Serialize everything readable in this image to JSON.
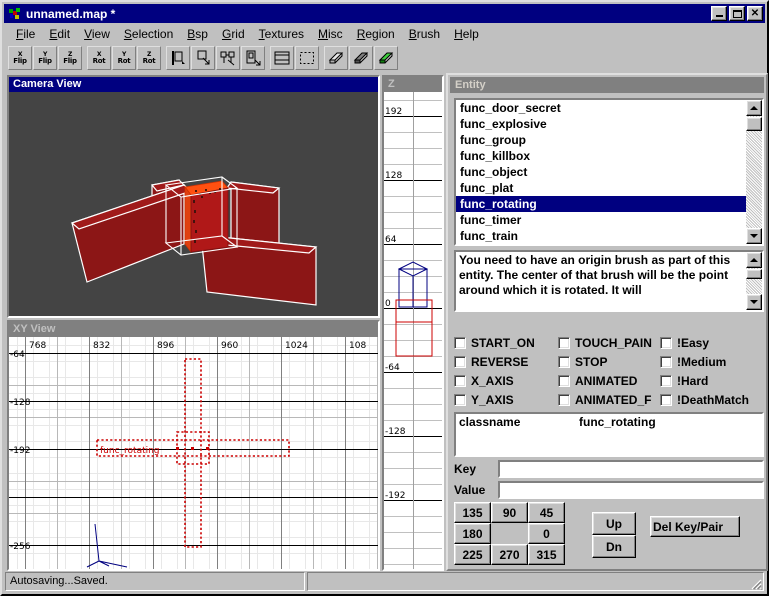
{
  "window": {
    "title": "unnamed.map *",
    "icon": "app-icon",
    "buttons": {
      "minimize": "_",
      "maximize": "□",
      "close": "×"
    }
  },
  "menu": {
    "items": [
      {
        "label": "File",
        "accel": "F"
      },
      {
        "label": "Edit",
        "accel": "E"
      },
      {
        "label": "View",
        "accel": "V"
      },
      {
        "label": "Selection",
        "accel": "S"
      },
      {
        "label": "Bsp",
        "accel": "B"
      },
      {
        "label": "Grid",
        "accel": "G"
      },
      {
        "label": "Textures",
        "accel": "T"
      },
      {
        "label": "Misc",
        "accel": "M"
      },
      {
        "label": "Region",
        "accel": "R"
      },
      {
        "label": "Brush",
        "accel": "B"
      },
      {
        "label": "Help",
        "accel": "H"
      }
    ]
  },
  "toolbar": {
    "buttons": [
      {
        "name": "x-flip-button",
        "top": "X",
        "bottom": "Flip",
        "icon": ""
      },
      {
        "name": "y-flip-button",
        "top": "Y",
        "bottom": "Flip",
        "icon": ""
      },
      {
        "name": "z-flip-button",
        "top": "Z",
        "bottom": "Flip",
        "icon": ""
      },
      {
        "name": "x-rotate-button",
        "top": "X",
        "bottom": "Rot",
        "icon": ""
      },
      {
        "name": "y-rotate-button",
        "top": "Y",
        "bottom": "Rot",
        "icon": ""
      },
      {
        "name": "z-rotate-button",
        "top": "Z",
        "bottom": "Rot",
        "icon": ""
      },
      {
        "name": "clipper-button",
        "top": "",
        "bottom": "",
        "icon": "clipper-icon"
      },
      {
        "name": "selection-drag-button",
        "top": "",
        "bottom": "",
        "icon": "drag-icon"
      },
      {
        "name": "entity-connect-button",
        "top": "",
        "bottom": "",
        "icon": "connect-icon"
      },
      {
        "name": "path-button",
        "top": "",
        "bottom": "",
        "icon": "path-icon"
      },
      {
        "name": "show-coordinates-button",
        "top": "",
        "bottom": "",
        "icon": "grid-window-icon"
      },
      {
        "name": "select-region-button",
        "top": "",
        "bottom": "",
        "icon": "marquee-icon"
      },
      {
        "name": "brush-cut-button",
        "top": "",
        "bottom": "",
        "icon": "brush-icon"
      },
      {
        "name": "brush-hollow-button",
        "top": "",
        "bottom": "",
        "icon": "brush-dark-icon"
      },
      {
        "name": "brush-make-button",
        "top": "",
        "bottom": "",
        "icon": "brush-green-icon"
      }
    ]
  },
  "camera_view": {
    "title": "Camera View"
  },
  "xy_view": {
    "title": "XY View",
    "x_ticks": [
      "768",
      "832",
      "896",
      "960",
      "1024",
      "108"
    ],
    "y_ticks": [
      "-64",
      "-128",
      "-192",
      "-256"
    ],
    "brush_label": "func_rotating"
  },
  "z_view": {
    "title": "Z",
    "ticks": [
      "192",
      "128",
      "64",
      "0",
      "-64",
      "-128",
      "-192"
    ]
  },
  "entity_panel": {
    "title": "Entity",
    "list": [
      "func_door_secret",
      "func_explosive",
      "func_group",
      "func_killbox",
      "func_object",
      "func_plat",
      "func_rotating",
      "func_timer",
      "func_train"
    ],
    "selected": "func_rotating",
    "description": "You need to have an origin brush as part of this entity.  The center of that brush will be the point around which it is rotated. It will",
    "flags": [
      [
        {
          "label": "START_ON",
          "checked": false
        },
        {
          "label": "TOUCH_PAIN",
          "checked": false
        },
        {
          "label": "!Easy",
          "checked": false
        }
      ],
      [
        {
          "label": "REVERSE",
          "checked": false
        },
        {
          "label": "STOP",
          "checked": false
        },
        {
          "label": "!Medium",
          "checked": false
        }
      ],
      [
        {
          "label": "X_AXIS",
          "checked": false
        },
        {
          "label": "ANIMATED",
          "checked": false
        },
        {
          "label": "!Hard",
          "checked": false
        }
      ],
      [
        {
          "label": "Y_AXIS",
          "checked": false
        },
        {
          "label": "ANIMATED_F",
          "checked": false
        },
        {
          "label": "!DeathMatch",
          "checked": false
        }
      ]
    ],
    "properties": [
      {
        "key": "classname",
        "value": "func_rotating"
      }
    ],
    "key_label": "Key",
    "key_value": "",
    "value_label": "Value",
    "value_value": "",
    "angle_buttons": [
      [
        "135",
        "90",
        "45"
      ],
      [
        "180",
        "",
        "0"
      ],
      [
        "225",
        "270",
        "315"
      ]
    ],
    "up_label": "Up",
    "down_label": "Dn",
    "delete_label": "Del Key/Pair"
  },
  "statusbar": {
    "message": "Autosaving...Saved.",
    "secondary": ""
  },
  "colors": {
    "titlebar_active": "#000080",
    "titlebar_inactive": "#808080",
    "face": "#c0c0c0",
    "brush_red": "#c00000",
    "brush_blue": "#000080",
    "camera_bg": "#444444",
    "selection_highlight": "#000080"
  }
}
